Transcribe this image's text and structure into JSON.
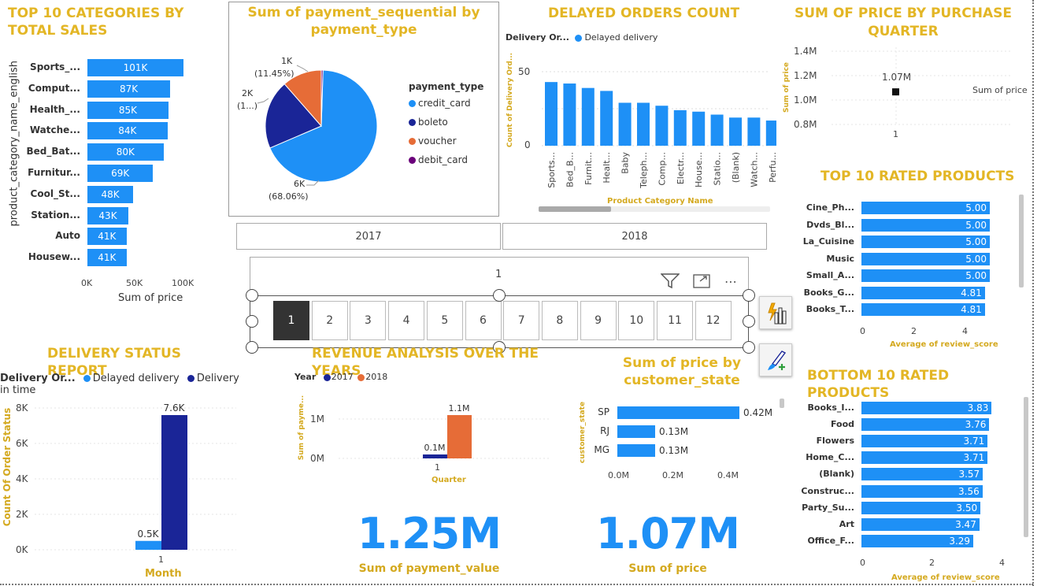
{
  "top10_categories": {
    "title": "TOP 10 CATEGORIES BY TOTAL SALES",
    "yaxis": "product_category_name_english",
    "xaxis": "Sum of price",
    "ticks": [
      "0K",
      "50K",
      "100K"
    ],
    "chart_data": {
      "type": "bar",
      "categories": [
        "Sports_...",
        "Comput...",
        "Health_...",
        "Watche...",
        "Bed_Bat...",
        "Furnitur...",
        "Cool_St...",
        "Station...",
        "Auto",
        "Housew..."
      ],
      "values": [
        101,
        87,
        85,
        84,
        80,
        69,
        48,
        43,
        41,
        41
      ],
      "labels": [
        "101K",
        "87K",
        "85K",
        "84K",
        "80K",
        "69K",
        "48K",
        "43K",
        "41K",
        "41K"
      ],
      "xlim": [
        0,
        110
      ]
    }
  },
  "pie": {
    "title_l1": "Sum of payment_sequential by",
    "title_l2": "payment_type",
    "legend_title": "payment_type",
    "chart_data": {
      "type": "pie",
      "series": [
        {
          "name": "credit_card",
          "value": 68.06,
          "color": "#1E90F6"
        },
        {
          "name": "boleto",
          "value": 20.0,
          "color": "#1A2597"
        },
        {
          "name": "voucher",
          "value": 11.45,
          "color": "#E66C37"
        },
        {
          "name": "debit_card",
          "value": 0.49,
          "color": "#6B007B"
        }
      ]
    },
    "label_1k_a": "1K",
    "label_1k_b": "(11.45%)",
    "label_2k_a": "2K",
    "label_2k_b": "(1...)",
    "label_6k_a": "6K",
    "label_6k_b": "(68.06%)"
  },
  "delayed": {
    "title": "DELAYED ORDERS COUNT",
    "legend_head": "Delivery Or...",
    "legend_item": "Delayed delivery",
    "yaxis": "Count of Delivery Ord...",
    "xaxis": "Product Category Name",
    "yticks": [
      "50",
      "0"
    ],
    "chart_data": {
      "type": "bar",
      "categories": [
        "Sports...",
        "Bed_B...",
        "Furnit...",
        "Healt...",
        "Baby",
        "Teleph...",
        "Comp...",
        "Electr...",
        "House...",
        "Statio...",
        "(Blank)",
        "Watch...",
        "Perfu..."
      ],
      "values": [
        43,
        42,
        39,
        37,
        29,
        29,
        27,
        24,
        23,
        21,
        19,
        19,
        17
      ],
      "ylim": [
        0,
        60
      ]
    }
  },
  "quarter": {
    "title_l1": "SUM OF PRICE BY PURCHASE",
    "title_l2": "QUARTER",
    "yaxis": "Sum of price",
    "legend": "Sum of price",
    "yticks": [
      "1.4M",
      "1.2M",
      "1.0M",
      "0.8M"
    ],
    "xtick": "1",
    "point_label": "1.07M",
    "chart_data": {
      "type": "scatter",
      "x": [
        1
      ],
      "y": [
        1.07
      ],
      "ylim": [
        0.8,
        1.4
      ]
    }
  },
  "years": {
    "y2017": "2017",
    "y2018": "2018"
  },
  "slicer": {
    "header": "1",
    "items": [
      "1",
      "2",
      "3",
      "4",
      "5",
      "6",
      "7",
      "8",
      "9",
      "10",
      "11",
      "12"
    ]
  },
  "top_rated": {
    "title": "TOP 10 RATED PRODUCTS",
    "xaxis": "Average of review_score",
    "ticks": [
      "0",
      "2",
      "4"
    ],
    "chart_data": {
      "type": "bar",
      "categories": [
        "Cine_Ph...",
        "Dvds_Bl...",
        "La_Cuisine",
        "Music",
        "Small_A...",
        "Books_G...",
        "Books_T..."
      ],
      "values": [
        5.0,
        5.0,
        5.0,
        5.0,
        5.0,
        4.81,
        4.81
      ],
      "labels": [
        "5.00",
        "5.00",
        "5.00",
        "5.00",
        "5.00",
        "4.81",
        "4.81"
      ],
      "xlim": [
        0,
        5
      ]
    }
  },
  "delivery_status": {
    "title": "DELIVERY STATUS REPORT",
    "legend_head": "Delivery Or...",
    "legend_a": "Delayed delivery",
    "legend_b": "Delivery in time",
    "yaxis": "Count Of Order Status",
    "xaxis": "Month",
    "yticks": [
      "8K",
      "6K",
      "4K",
      "2K",
      "0K"
    ],
    "xtick": "1",
    "chart_data": {
      "type": "bar",
      "categories": [
        "1"
      ],
      "series": [
        {
          "name": "Delayed delivery",
          "values": [
            0.5
          ],
          "label": "0.5K"
        },
        {
          "name": "Delivery in time",
          "values": [
            7.6
          ],
          "label": "7.6K"
        }
      ],
      "ylim": [
        0,
        8
      ]
    }
  },
  "revenue": {
    "title": "REVENUE ANALYSIS OVER THE YEARS",
    "legend_head": "Year",
    "legend_a": "2017",
    "legend_b": "2018",
    "yaxis": "Sum of payme...",
    "xaxis": "Quarter",
    "yticks": [
      "1M",
      "0M"
    ],
    "xtick": "1",
    "chart_data": {
      "type": "bar",
      "categories": [
        "1"
      ],
      "series": [
        {
          "name": "2017",
          "values": [
            0.1
          ],
          "label": "0.1M"
        },
        {
          "name": "2018",
          "values": [
            1.1
          ],
          "label": "1.1M"
        }
      ],
      "ylim": [
        0,
        1.2
      ]
    }
  },
  "state": {
    "title_l1": "Sum of price by",
    "title_l2": "customer_state",
    "yaxis": "customer_state",
    "ticks": [
      "0.0M",
      "0.2M",
      "0.4M"
    ],
    "chart_data": {
      "type": "bar",
      "categories": [
        "SP",
        "RJ",
        "MG"
      ],
      "values": [
        0.42,
        0.13,
        0.13
      ],
      "labels": [
        "0.42M",
        "0.13M",
        "0.13M"
      ],
      "xlim": [
        0,
        0.45
      ]
    }
  },
  "bottom_rated": {
    "title": "BOTTOM 10 RATED PRODUCTS",
    "xaxis": "Average of review_score",
    "ticks": [
      "0",
      "2",
      "4"
    ],
    "chart_data": {
      "type": "bar",
      "categories": [
        "Books_I...",
        "Food",
        "Flowers",
        "Home_C...",
        "(Blank)",
        "Construc...",
        "Party_Su...",
        "Art",
        "Office_F..."
      ],
      "values": [
        3.83,
        3.76,
        3.71,
        3.71,
        3.57,
        3.56,
        3.5,
        3.47,
        3.29
      ],
      "labels": [
        "3.83",
        "3.76",
        "3.71",
        "3.71",
        "3.57",
        "3.56",
        "3.50",
        "3.47",
        "3.29"
      ],
      "xlim": [
        0,
        4.4
      ]
    }
  },
  "kpi1": {
    "value": "1.25M",
    "label": "Sum of payment_value"
  },
  "kpi2": {
    "value": "1.07M",
    "label": "Sum of price"
  },
  "colors": {
    "blue": "#1E90F6",
    "navy": "#1A2597",
    "orange": "#E66C37",
    "purple": "#6B007B",
    "gold": "#E3B625"
  },
  "icons": [
    "filter-icon",
    "focus-mode-icon",
    "more-options-icon",
    "quick-insights-icon",
    "format-paint-icon"
  ]
}
